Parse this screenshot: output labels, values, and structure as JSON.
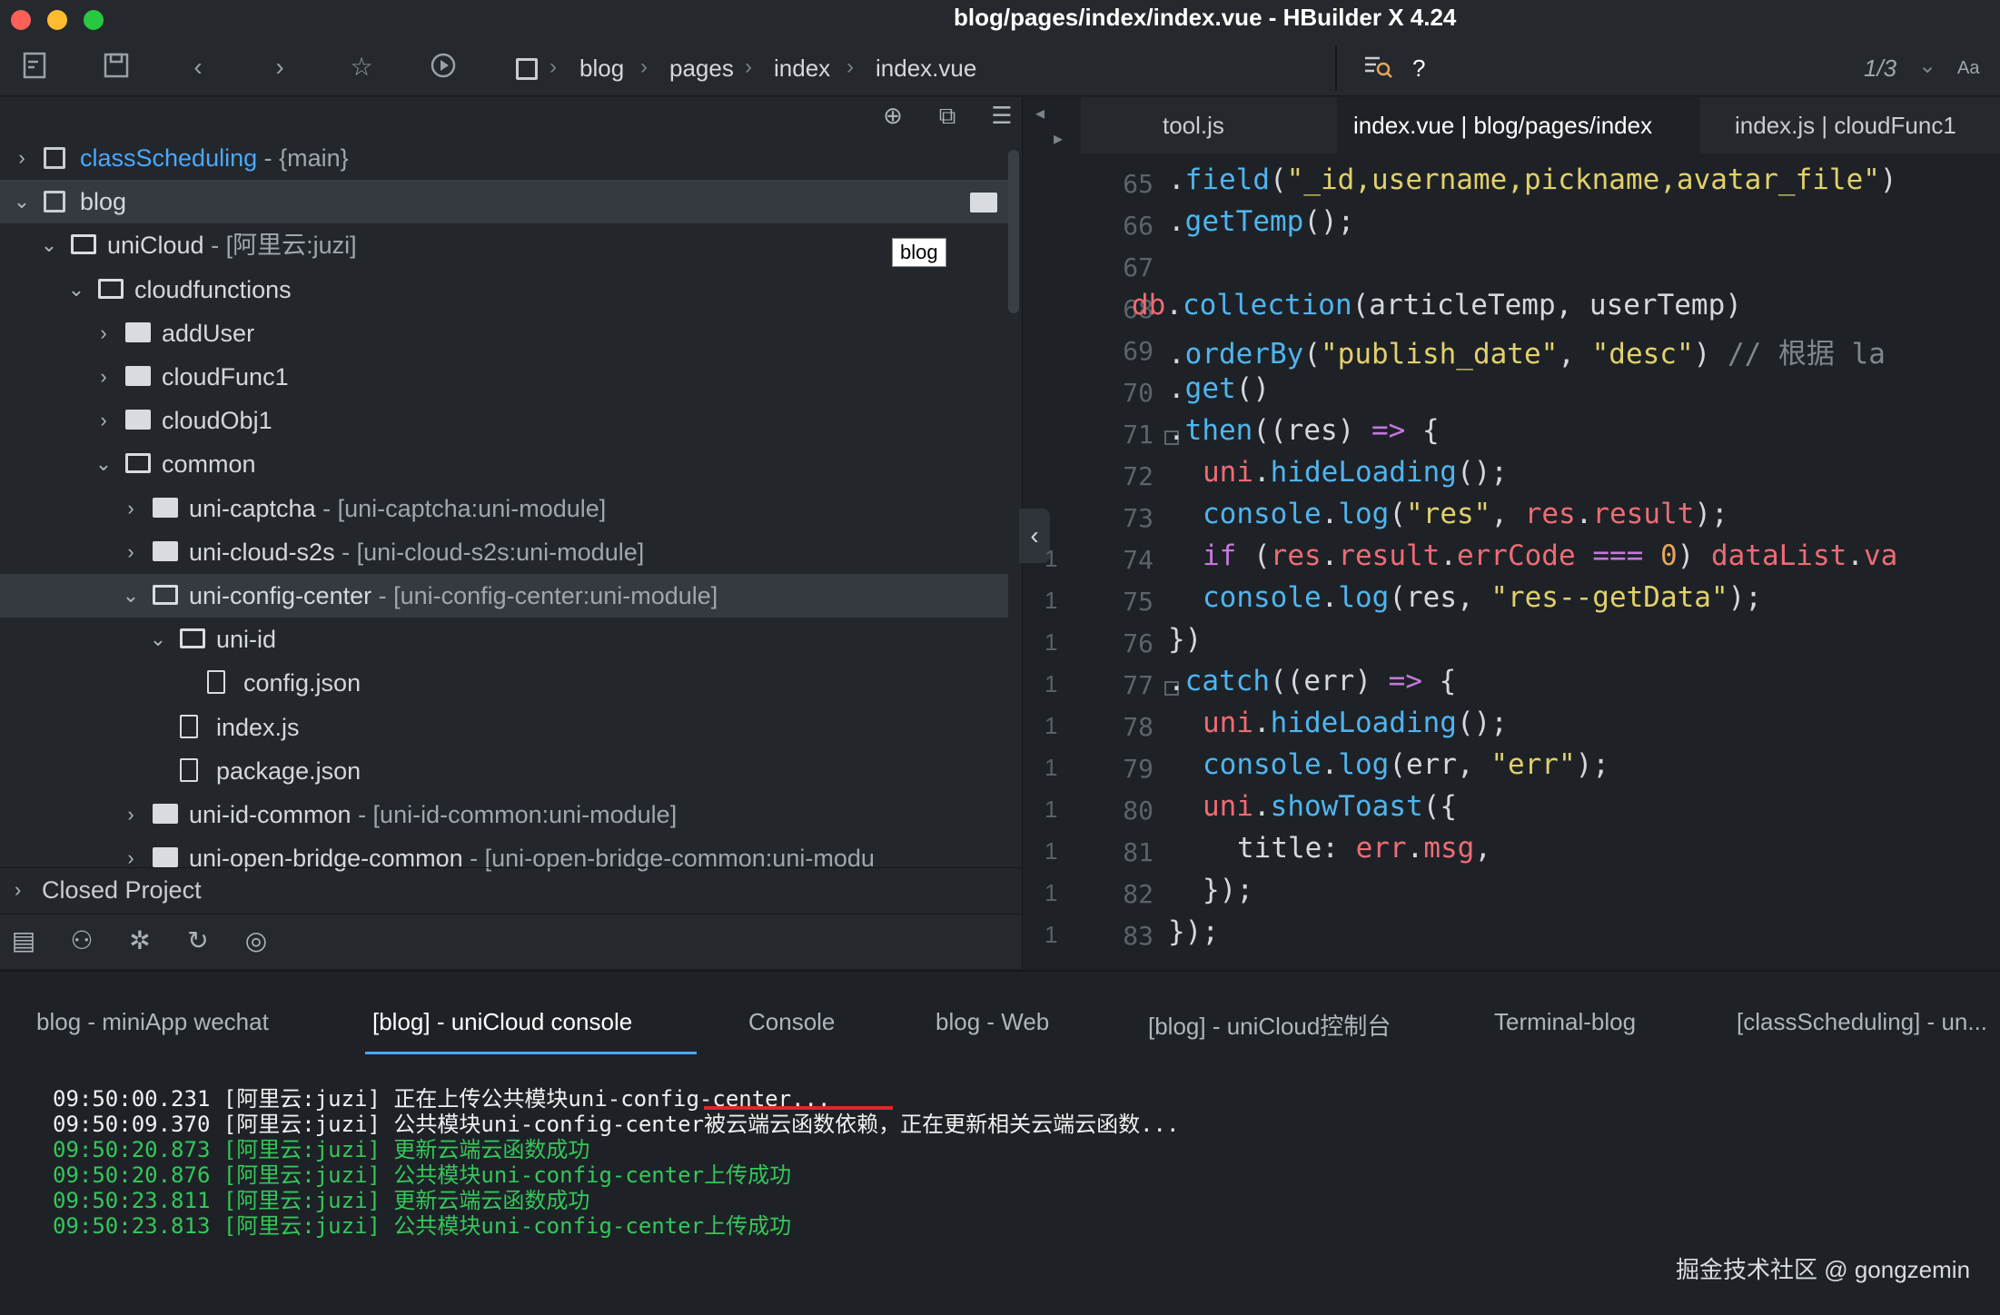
{
  "window": {
    "title": "blog/pages/index/index.vue - HBuilder X 4.24",
    "traffic_colors": [
      "#fe5f57",
      "#febc2e",
      "#28c840"
    ]
  },
  "toolbar": {
    "icons": [
      "new-file-icon",
      "save-icon",
      "back-icon",
      "forward-icon",
      "star-icon",
      "run-icon"
    ],
    "breadcrumb": [
      "blog",
      "pages",
      "index",
      "index.vue"
    ],
    "search_hint": "?",
    "match_count": "1/3",
    "case_toggle": "Aa"
  },
  "tree": {
    "tooltip": "blog",
    "items": [
      {
        "label": "classScheduling",
        "suffix": " - {main}",
        "level": 0,
        "chev": "›",
        "kind": "project",
        "blue": true
      },
      {
        "label": "blog",
        "suffix": "",
        "level": 0,
        "chev": "⌄",
        "kind": "project",
        "selected": true
      },
      {
        "label": "uniCloud",
        "suffix": " - [阿里云:juzi]",
        "level": 1,
        "chev": "⌄",
        "kind": "folder-open"
      },
      {
        "label": "cloudfunctions",
        "suffix": "",
        "level": 2,
        "chev": "⌄",
        "kind": "folder-open"
      },
      {
        "label": "addUser",
        "suffix": "",
        "level": 3,
        "chev": "›",
        "kind": "folder"
      },
      {
        "label": "cloudFunc1",
        "suffix": "",
        "level": 3,
        "chev": "›",
        "kind": "folder"
      },
      {
        "label": "cloudObj1",
        "suffix": "",
        "level": 3,
        "chev": "›",
        "kind": "folder"
      },
      {
        "label": "common",
        "suffix": "",
        "level": 3,
        "chev": "⌄",
        "kind": "folder-open"
      },
      {
        "label": "uni-captcha",
        "suffix": " - [uni-captcha:uni-module]",
        "level": 4,
        "chev": "›",
        "kind": "folder"
      },
      {
        "label": "uni-cloud-s2s",
        "suffix": " - [uni-cloud-s2s:uni-module]",
        "level": 4,
        "chev": "›",
        "kind": "folder"
      },
      {
        "label": "uni-config-center",
        "suffix": " - [uni-config-center:uni-module]",
        "level": 4,
        "chev": "⌄",
        "kind": "folder-open",
        "selected": true
      },
      {
        "label": "uni-id",
        "suffix": "",
        "level": 5,
        "chev": "⌄",
        "kind": "folder-open"
      },
      {
        "label": "config.json",
        "suffix": "",
        "level": 6,
        "chev": "",
        "kind": "file"
      },
      {
        "label": "index.js",
        "suffix": "",
        "level": 5,
        "chev": "",
        "kind": "file"
      },
      {
        "label": "package.json",
        "suffix": "",
        "level": 5,
        "chev": "",
        "kind": "file"
      },
      {
        "label": "uni-id-common",
        "suffix": " - [uni-id-common:uni-module]",
        "level": 4,
        "chev": "›",
        "kind": "folder"
      },
      {
        "label": "uni-open-bridge-common",
        "suffix": " - [uni-open-bridge-common:uni-modu",
        "level": 4,
        "chev": "›",
        "kind": "folder"
      }
    ],
    "closed_project": "Closed Project",
    "bottom_icons": [
      "project-icon",
      "binoculars-icon",
      "bug-icon",
      "cloud-sync-icon",
      "globe-icon"
    ]
  },
  "editor": {
    "tabs": [
      "tool.js",
      "index.vue | blog/pages/index",
      "index.js | cloudFunc1"
    ],
    "active_tab": 1,
    "line_numbers": [
      "65",
      "66",
      "67",
      "68",
      "69",
      "70",
      "71",
      "72",
      "73",
      "74",
      "75",
      "76",
      "77",
      "78",
      "79",
      "80",
      "81",
      "82",
      "83"
    ],
    "mini_marks": [
      "1",
      "1",
      "1",
      "1",
      "1",
      "1",
      "1",
      "1",
      "1",
      "1"
    ]
  },
  "console": {
    "tabs": [
      "blog - miniApp wechat",
      "[blog] - uniCloud console",
      "Console",
      "blog - Web",
      "[blog] - uniCloud控制台",
      "Terminal-blog",
      "[classScheduling] - un..."
    ],
    "active_tab": 1,
    "lines": [
      {
        "text": "09:50:00.231 [阿里云:juzi] 正在上传公共模块uni-config-center...",
        "color": "w"
      },
      {
        "text": "09:50:09.370 [阿里云:juzi] 公共模块uni-config-center被云端云函数依赖，正在更新相关云端云函数...",
        "color": "w"
      },
      {
        "text": "09:50:20.873 [阿里云:juzi] 更新云端云函数成功",
        "color": "g"
      },
      {
        "text": "09:50:20.876 [阿里云:juzi] 公共模块uni-config-center上传成功",
        "color": "g"
      },
      {
        "text": "09:50:23.811 [阿里云:juzi] 更新云端云函数成功",
        "color": "g"
      },
      {
        "text": "09:50:23.813 [阿里云:juzi] 公共模块uni-config-center上传成功",
        "color": "g"
      }
    ]
  },
  "watermark": "掘金技术社区 @ gongzemin"
}
